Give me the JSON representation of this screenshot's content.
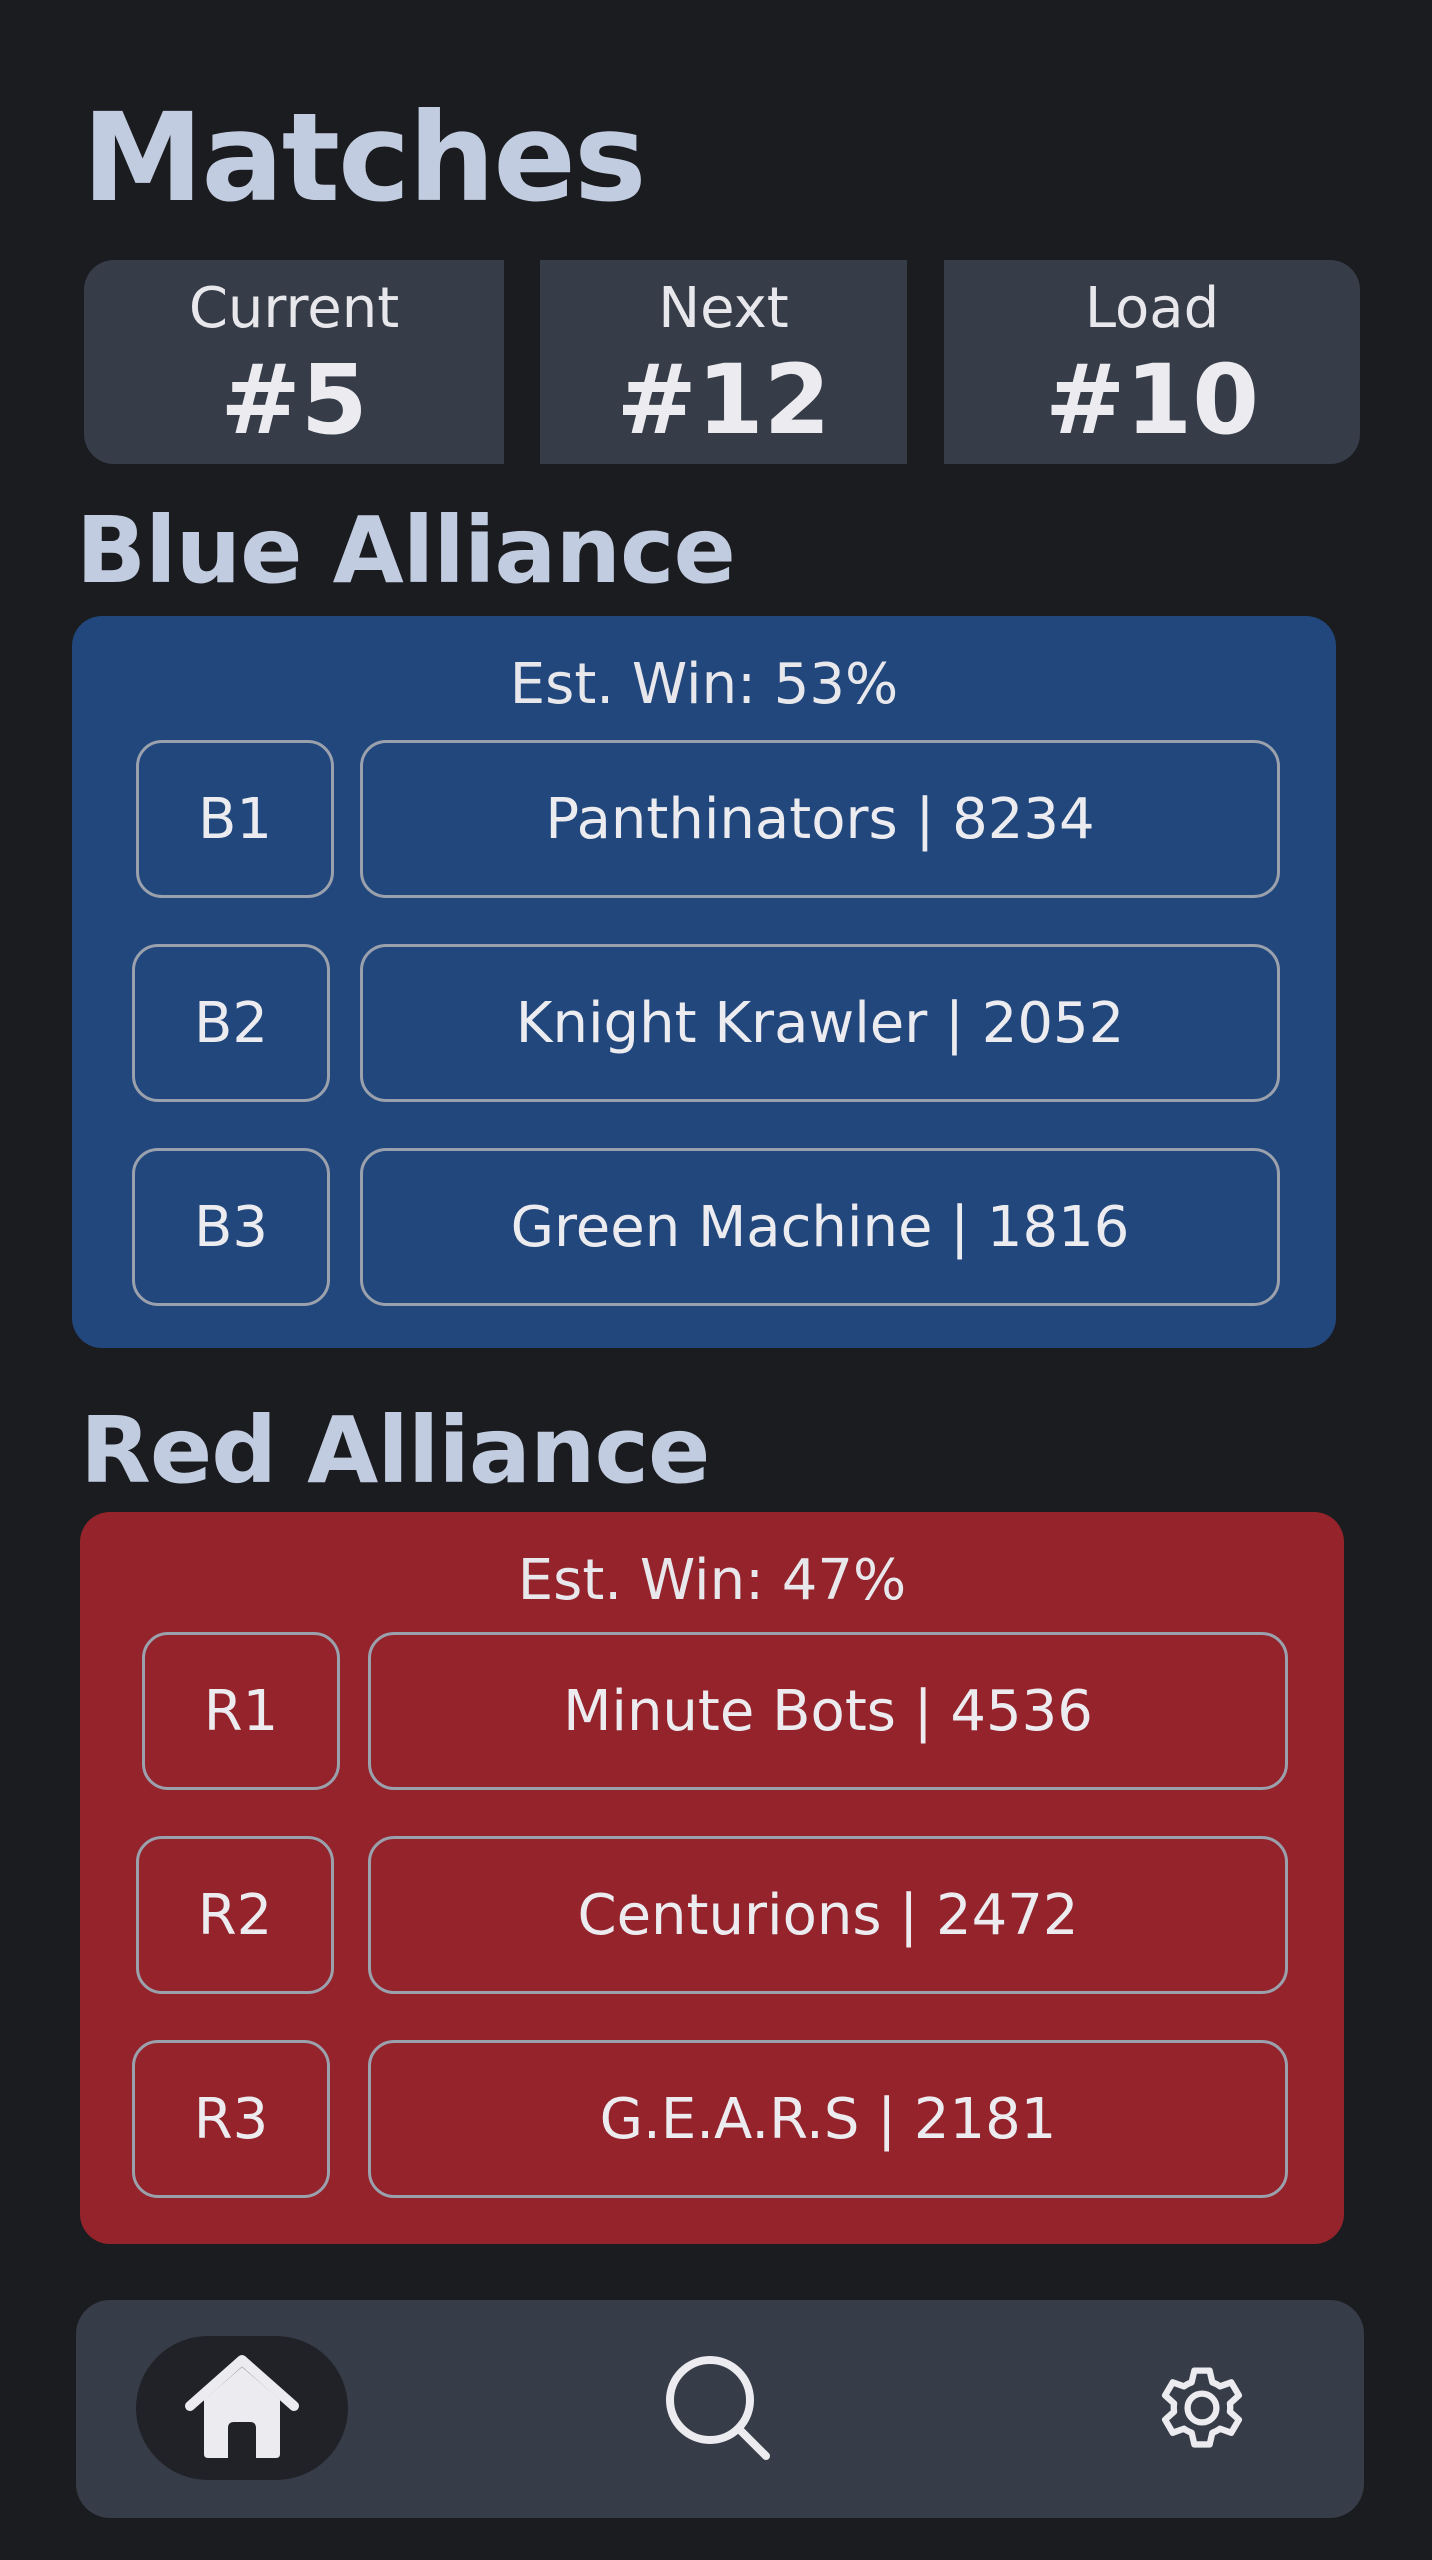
{
  "page": {
    "title": "Matches"
  },
  "stats": {
    "current": {
      "label": "Current",
      "value": "#5"
    },
    "next": {
      "label": "Next",
      "value": "#12"
    },
    "load": {
      "label": "Load",
      "value": "#10"
    }
  },
  "blue_alliance": {
    "title": "Blue Alliance",
    "est_win": "Est. Win: 53%",
    "color": "#21477c",
    "teams": [
      {
        "slot": "B1",
        "team": "Panthinators | 8234"
      },
      {
        "slot": "B2",
        "team": "Knight Krawler | 2052"
      },
      {
        "slot": "B3",
        "team": "Green Machine | 1816"
      }
    ]
  },
  "red_alliance": {
    "title": "Red Alliance",
    "est_win": "Est. Win: 47%",
    "color": "#94232b",
    "teams": [
      {
        "slot": "R1",
        "team": "Minute Bots | 4536"
      },
      {
        "slot": "R2",
        "team": "Centurions | 2472"
      },
      {
        "slot": "R3",
        "team": "G.E.A.R.S | 2181"
      }
    ]
  },
  "nav": {
    "items": [
      {
        "icon": "home-icon",
        "active": true
      },
      {
        "icon": "search-icon",
        "active": false
      },
      {
        "icon": "gear-icon",
        "active": false
      }
    ]
  }
}
